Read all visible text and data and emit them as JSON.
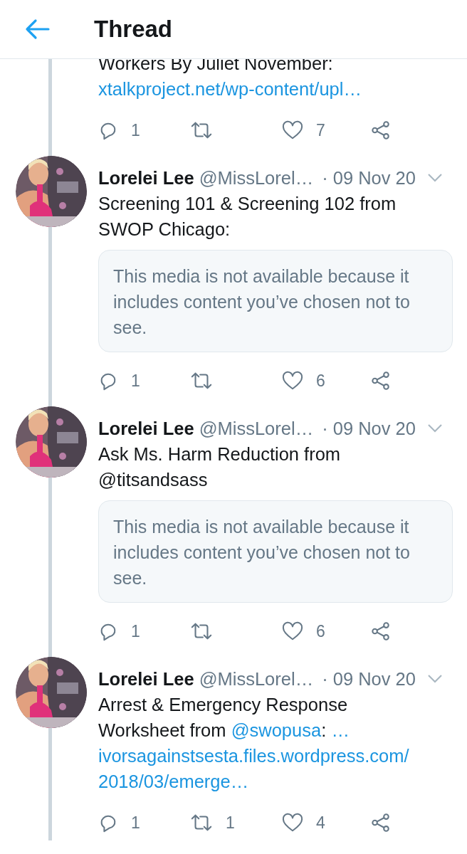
{
  "header": {
    "title": "Thread"
  },
  "tweets": [
    {
      "body": [
        {
          "kind": "text",
          "text": "Workers By Juliet November:"
        },
        {
          "kind": "break"
        },
        {
          "kind": "link",
          "text": "xtalkproject.net/wp-content/upl…"
        }
      ],
      "replies": "1",
      "likes": "7"
    },
    {
      "author": "Lorelei Lee",
      "handle": "@MissLorel…",
      "date": "· 09 Nov 20",
      "body": [
        {
          "kind": "text",
          "text": "Screening 101 & Screening 102 from"
        },
        {
          "kind": "break"
        },
        {
          "kind": "text",
          "text": "SWOP Chicago:"
        }
      ],
      "media_notice": "This media is not available because it includes content you’ve chosen not to see.",
      "replies": "1",
      "likes": "6"
    },
    {
      "author": "Lorelei Lee",
      "handle": "@MissLorel…",
      "date": "· 09 Nov 20",
      "body": [
        {
          "kind": "text",
          "text": "Ask Ms. Harm Reduction from"
        },
        {
          "kind": "break"
        },
        {
          "kind": "text",
          "text": "@titsandsass"
        }
      ],
      "media_notice": "This media is not available because it includes content you’ve chosen not to see.",
      "replies": "1",
      "likes": "6"
    },
    {
      "author": "Lorelei Lee",
      "handle": "@MissLorel…",
      "date": "· 09 Nov 20",
      "body": [
        {
          "kind": "text",
          "text": "Arrest & Emergency Response"
        },
        {
          "kind": "break"
        },
        {
          "kind": "text",
          "text": "Worksheet from"
        },
        {
          "kind": "space"
        },
        {
          "kind": "link",
          "text": "@swopusa"
        },
        {
          "kind": "text",
          "text": ":"
        },
        {
          "kind": "space"
        },
        {
          "kind": "link",
          "text": "…"
        },
        {
          "kind": "break"
        },
        {
          "kind": "link",
          "text": "ivorsagainstsesta.files.wordpress.com/"
        },
        {
          "kind": "break"
        },
        {
          "kind": "link",
          "text": "2018/03/emerge…"
        }
      ],
      "replies": "1",
      "retweets": "1",
      "likes": "4"
    }
  ]
}
